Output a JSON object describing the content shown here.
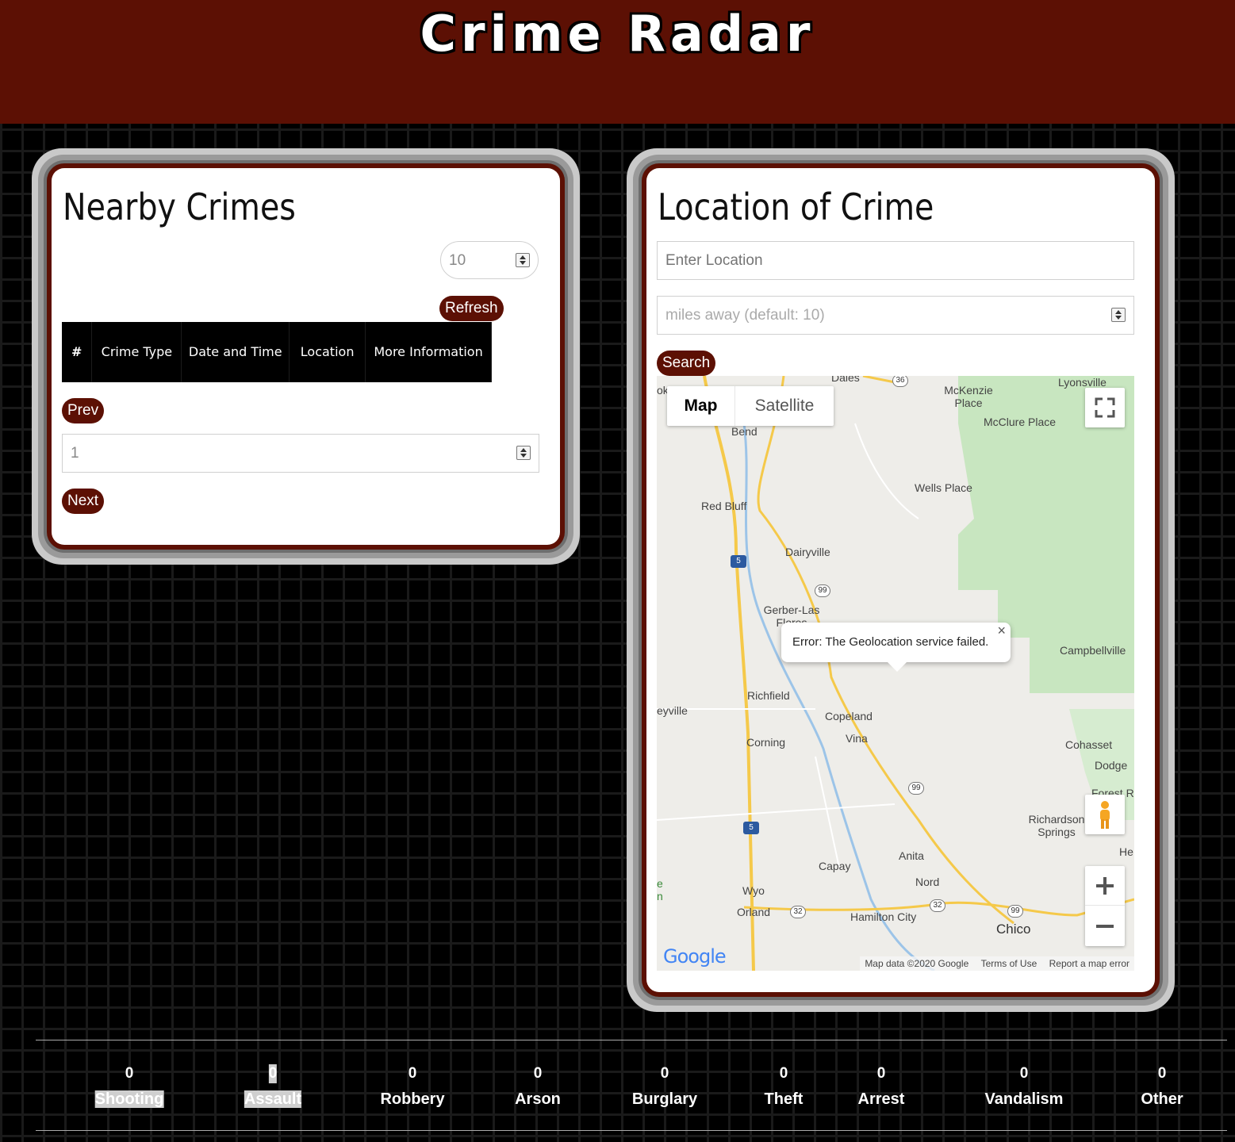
{
  "header": {
    "title": "Crime Radar"
  },
  "nearby": {
    "title": "Nearby Crimes",
    "count_value": "10",
    "refresh_label": "Refresh",
    "table_headers": [
      "#",
      "Crime Type",
      "Date and Time",
      "Location",
      "More Information"
    ],
    "prev_label": "Prev",
    "page_value": "1",
    "next_label": "Next"
  },
  "location": {
    "title": "Location of Crime",
    "location_placeholder": "Enter Location",
    "miles_placeholder": "miles away (default: 10)",
    "search_label": "Search"
  },
  "map": {
    "type_map": "Map",
    "type_satellite": "Satellite",
    "error_message": "Error: The Geolocation service failed.",
    "close_symbol": "×",
    "places": [
      "Dales",
      "McKenzie Place",
      "Lyonsville",
      "McClure Place",
      "Bend",
      "Wells Place",
      "Red Bluff",
      "Dairyville",
      "Gerber-Las Flores",
      "Campbellville",
      "Richfield",
      "eyville",
      "Copeland",
      "Vina",
      "Corning",
      "Cohasset",
      "Dodge",
      "Forest R",
      "Richardson Springs",
      "He",
      "Anita",
      "Capay",
      "Nord",
      "Wyo",
      "Orland",
      "Hamilton City",
      "Chico",
      "ok",
      "e n"
    ],
    "route_shields": [
      "36",
      "5",
      "99",
      "99",
      "5",
      "32",
      "32",
      "99"
    ],
    "attribution": "Map data ©2020 Google",
    "terms": "Terms of Use",
    "report": "Report a map error",
    "logo": "Google",
    "colors": {
      "land": "#eeede9",
      "forest": "#c8e6c0",
      "highway": "#f5c94a",
      "water": "#9cc4e8"
    }
  },
  "stats": [
    {
      "count": "0",
      "label": "Shooting"
    },
    {
      "count": "0",
      "label": "Assault"
    },
    {
      "count": "0",
      "label": "Robbery"
    },
    {
      "count": "0",
      "label": "Arson"
    },
    {
      "count": "0",
      "label": "Burglary"
    },
    {
      "count": "0",
      "label": "Theft"
    },
    {
      "count": "0",
      "label": "Arrest"
    },
    {
      "count": "0",
      "label": "Vandalism"
    },
    {
      "count": "0",
      "label": "Other"
    }
  ],
  "colors": {
    "brand": "#5c1004",
    "background": "#000000"
  }
}
